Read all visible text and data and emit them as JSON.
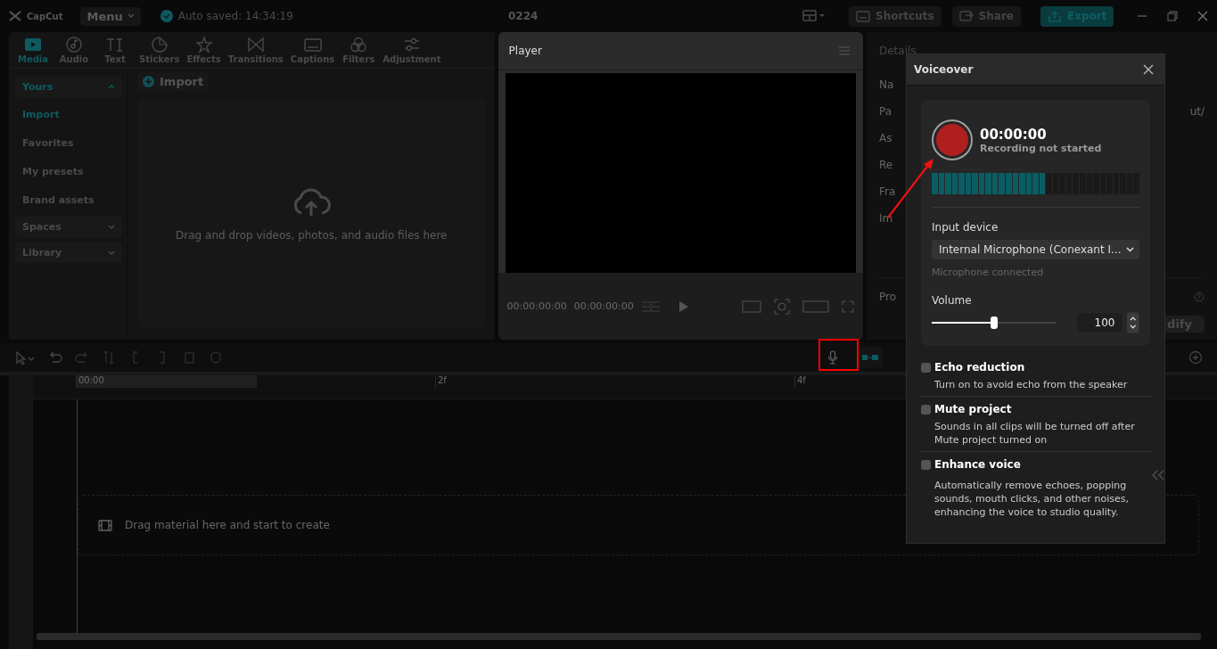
{
  "title_bar": {
    "logo": "CapCut",
    "menu": "Menu",
    "autosave": "Auto saved: 14:34:19",
    "project": "0224",
    "buttons": [
      {
        "label": "Shortcuts",
        "kind": "plain"
      },
      {
        "label": "Share",
        "kind": "plain"
      },
      {
        "label": "Export",
        "kind": "primary"
      }
    ]
  },
  "tool_tabs": [
    {
      "label": "Media",
      "selected": true
    },
    {
      "label": "Audio",
      "selected": false
    },
    {
      "label": "Text",
      "selected": false
    },
    {
      "label": "Stickers",
      "selected": false
    },
    {
      "label": "Effects",
      "selected": false
    },
    {
      "label": "Transitions",
      "selected": false
    },
    {
      "label": "Captions",
      "selected": false
    },
    {
      "label": "Filters",
      "selected": false
    },
    {
      "label": "Adjustment",
      "selected": false
    }
  ],
  "sidebar": {
    "items": [
      {
        "label": "Yours",
        "kind": "group",
        "expanded": true,
        "selected": true
      },
      {
        "label": "Import",
        "kind": "item",
        "selected": true
      },
      {
        "label": "Favorites",
        "kind": "item",
        "selected": false
      },
      {
        "label": "My presets",
        "kind": "item",
        "selected": false
      },
      {
        "label": "Brand assets",
        "kind": "item",
        "selected": false
      },
      {
        "label": "Spaces",
        "kind": "group",
        "expanded": false,
        "selected": false
      },
      {
        "label": "Library",
        "kind": "group",
        "expanded": false,
        "selected": false
      }
    ]
  },
  "media": {
    "import_button": "Import",
    "drop_hint": "Drag and drop videos, photos, and audio files here"
  },
  "player": {
    "title": "Player",
    "current_time": "00:00:00:00",
    "duration": "00:00:00:00"
  },
  "details": {
    "title": "Details",
    "labels": [
      "Na",
      "Pa",
      "As",
      "Re",
      "Fra",
      "Im"
    ],
    "path_tail": "ut/",
    "project_label": "Pro",
    "modify_button": "dify"
  },
  "timeline": {
    "ticks": [
      "00:00",
      "2f",
      "4f"
    ],
    "empty_hint": "Drag material here and start to create"
  },
  "voiceover": {
    "title": "Voiceover",
    "timer": "00:00:00",
    "status": "Recording not started",
    "meter": {
      "level": 0.55
    },
    "input_label": "Input device",
    "device": "Internal Microphone (Conexant I...",
    "mic_status": "Microphone connected",
    "volume_label": "Volume",
    "volume": {
      "level": 0.5
    },
    "volume_value": "100",
    "options": [
      {
        "title": "Echo reduction",
        "description": "Turn on to avoid echo from the speaker",
        "checked": false
      },
      {
        "title": "Mute project",
        "description": "Sounds in all clips will be turned off after Mute project turned on",
        "checked": false
      },
      {
        "title": "Enhance voice",
        "description": "Automatically remove echoes, popping sounds, mouth clicks, and other noises, enhancing the voice to studio quality.",
        "checked": false
      }
    ]
  }
}
